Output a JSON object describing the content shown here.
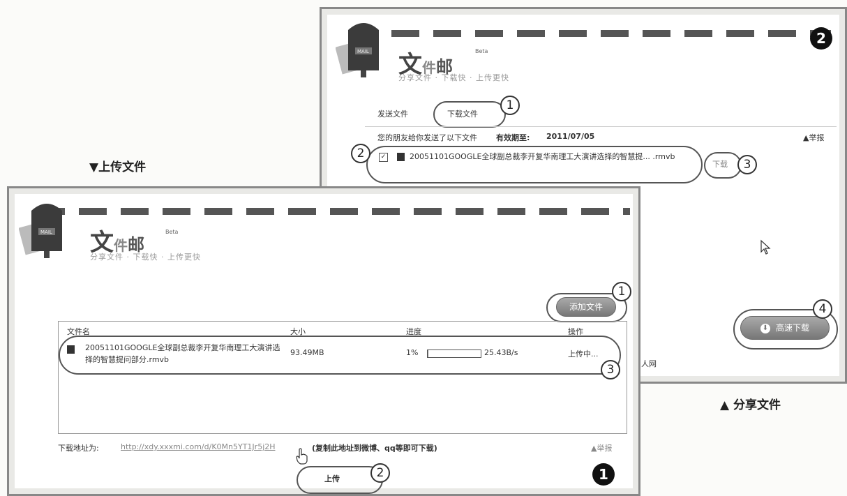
{
  "labels": {
    "upload_caption": "▼上传文件",
    "share_caption": "▲ 分享文件"
  },
  "share_window": {
    "badge": "2",
    "logo": {
      "c1": "文",
      "c2": "件",
      "c3": "邮",
      "beta": "Beta"
    },
    "slogan": "分享文件 · 下载快 · 上传更快",
    "tabs": {
      "send": "发送文件",
      "download": "下载文件"
    },
    "notice": "您的朋友给你发送了以下文件",
    "validity_label": "有效期至:",
    "validity_date": "2011/07/05",
    "report": "举报",
    "file_name": "20051101GOOGLE全球副总裁李开复华南理工大演讲选择的智慧提... .rmvb",
    "download_link": "下载",
    "download_button": "高速下载",
    "footer_fragment": "人网",
    "markers": {
      "m1": "1",
      "m2": "2",
      "m3": "3",
      "m4": "4"
    }
  },
  "upload_window": {
    "badge": "1",
    "logo": {
      "c1": "文",
      "c2": "件",
      "c3": "邮",
      "beta": "Beta"
    },
    "slogan": "分享文件 · 下载快 · 上传更快",
    "add_file_button": "添加文件",
    "table": {
      "headers": [
        "文件名",
        "大小",
        "进度",
        "操作"
      ],
      "row": {
        "name": "20051101GOOGLE全球副总裁李开复华南理工大演讲选择的智慧提问部分.rmvb",
        "size": "93.49MB",
        "progress_text": "1%",
        "progress_value": 0.01,
        "speed": "25.43B/s",
        "action": "上传中..."
      }
    },
    "download_url_label": "下载地址为:",
    "download_url": "http://xdy.xxxmi.com/d/K0Mn5YT1Jr5j2H",
    "copy_hint": "(复制此地址到微博、qq等即可下载)",
    "report": "举报",
    "upload_button": "上传",
    "markers": {
      "m1": "1",
      "m2": "2",
      "m3": "3"
    }
  }
}
